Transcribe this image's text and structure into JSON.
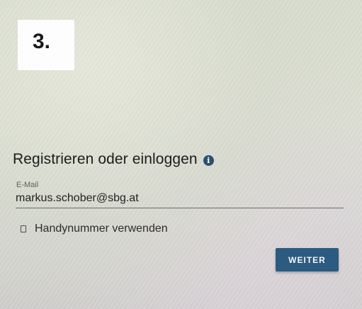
{
  "step": {
    "label": "3."
  },
  "form": {
    "heading": "Registrieren oder einloggen",
    "info_icon": "i",
    "email": {
      "label": "E-Mail",
      "value": "markus.schober@sbg.at"
    },
    "phone_option": {
      "label": "Handynummer verwenden",
      "checked": false
    },
    "submit_label": "WEITER"
  },
  "colors": {
    "accent": "#2b5b80",
    "info_icon": "#2a4f72"
  },
  "icons": {
    "info": "info-icon",
    "checkbox": "checkbox-icon"
  }
}
